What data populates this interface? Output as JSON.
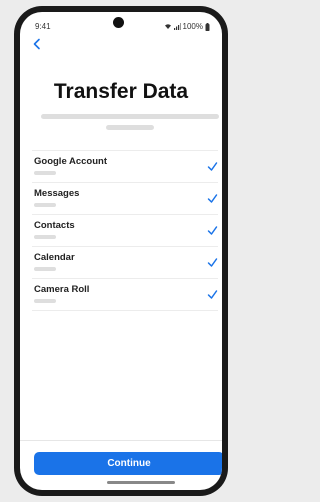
{
  "status_bar": {
    "time": "9:41",
    "battery": "100%"
  },
  "header": {
    "back_icon": "chevron-left-icon",
    "title": "Transfer Data"
  },
  "items": [
    {
      "label": "Google Account",
      "checked": true
    },
    {
      "label": "Messages",
      "checked": true
    },
    {
      "label": "Contacts",
      "checked": true
    },
    {
      "label": "Calendar",
      "checked": true
    },
    {
      "label": "Camera Roll",
      "checked": true
    }
  ],
  "footer": {
    "button_label": "Continue"
  },
  "colors": {
    "accent": "#1a73e8",
    "text": "#111111"
  }
}
